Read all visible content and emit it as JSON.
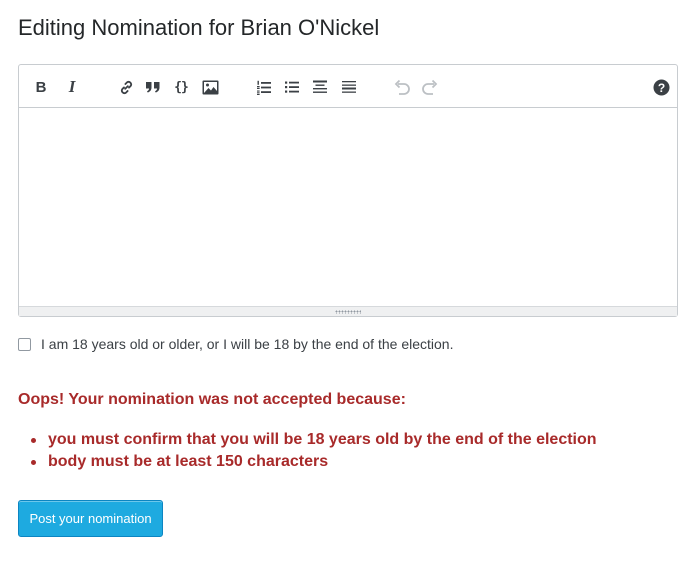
{
  "page": {
    "title": "Editing Nomination for Brian O'Nickel"
  },
  "toolbar": {
    "bold_glyph": "B",
    "italic_glyph": "I",
    "code_glyph": "{}",
    "help_glyph": "?",
    "icons": [
      "bold-icon",
      "italic-icon",
      "link-icon",
      "blockquote-icon",
      "code-icon",
      "image-icon",
      "ordered-list-icon",
      "bulleted-list-icon",
      "heading-icon",
      "horizontal-rule-icon",
      "undo-icon",
      "redo-icon",
      "help-icon"
    ]
  },
  "editor": {
    "body_value": ""
  },
  "confirm": {
    "label": "I am 18 years old or older, or I will be 18 by the end of the election.",
    "checked": false
  },
  "errors": {
    "heading": "Oops! Your nomination was not accepted because:",
    "items": [
      "you must confirm that you will be 18 years old by the end of the election",
      "body must be at least 150 characters"
    ]
  },
  "actions": {
    "post_label": "Post your nomination"
  },
  "colors": {
    "error": "#a82a2a",
    "primary_button": "#1eaae0",
    "text": "#242729"
  }
}
